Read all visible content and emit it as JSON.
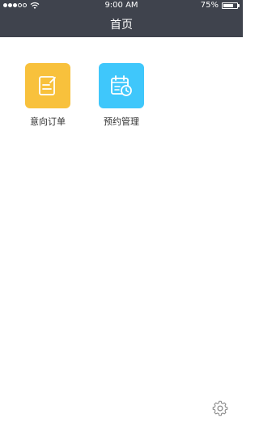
{
  "status_bar": {
    "time": "9:00 AM",
    "battery_percent_text": "75%",
    "battery_level": 0.75,
    "signal_bars_filled": 3,
    "signal_bars_total": 5
  },
  "nav": {
    "title": "首页"
  },
  "tiles": [
    {
      "label": "意向订单",
      "icon": "note-edit-icon",
      "color": "#f8c13c"
    },
    {
      "label": "预约管理",
      "icon": "calendar-clock-icon",
      "color": "#3fc7fb"
    }
  ],
  "footer": {
    "settings_icon": "gear-icon"
  },
  "colors": {
    "topbar": "#3f434d",
    "background": "#ffffff",
    "label_text": "#333333",
    "gear": "#8a8a8a"
  }
}
